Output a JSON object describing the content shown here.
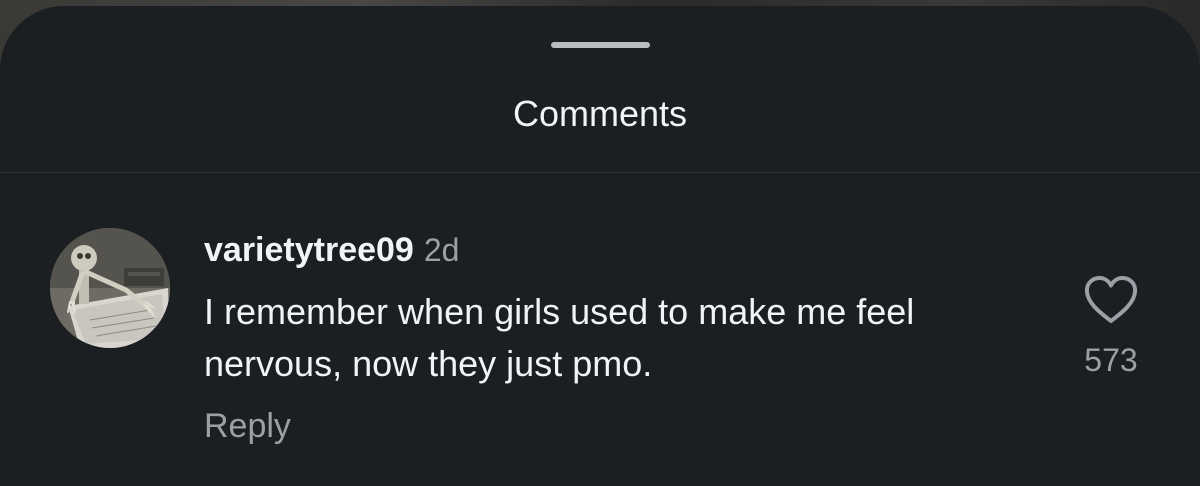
{
  "sheet": {
    "title": "Comments"
  },
  "comment": {
    "username": "varietytree09",
    "timestamp": "2d",
    "text": "I remember when girls used to make me feel nervous, now they just pmo.",
    "reply_label": "Reply",
    "like_count": "573",
    "like_icon": "heart-icon",
    "avatar_icon": "skeleton-avatar"
  },
  "colors": {
    "sheet_background": "#1b1f22",
    "primary_text": "#f2f3f4",
    "secondary_text": "#9aa0a6"
  }
}
